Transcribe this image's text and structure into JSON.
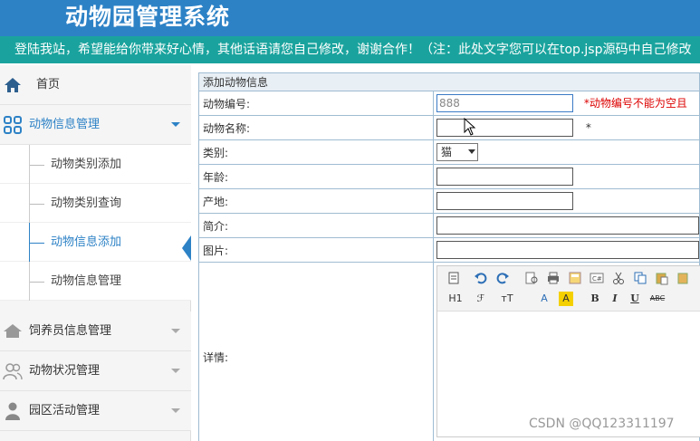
{
  "header": {
    "app_title": "动物园管理系统",
    "marquee": "登陆我站，希望能给你带来好心情，其他话语请您自己修改，谢谢合作！（注：此处文字您可以在top.jsp源码中自己修改"
  },
  "sidebar": {
    "home": "首页",
    "animal_info_mgmt": "动物信息管理",
    "sub_items": [
      "动物类别添加",
      "动物类别查询",
      "动物信息添加",
      "动物信息管理"
    ],
    "keeper_mgmt": "饲养员信息管理",
    "status_mgmt": "动物状况管理",
    "activity_mgmt": "园区活动管理"
  },
  "form": {
    "caption": "添加动物信息",
    "labels": {
      "code": "动物编号:",
      "name": "动物名称:",
      "category": "类别:",
      "age": "年龄:",
      "origin": "产地:",
      "intro": "简介:",
      "image": "图片:",
      "detail": "详情:"
    },
    "values": {
      "code": "888",
      "name": "",
      "category": "猫",
      "age": "",
      "origin": "",
      "intro": "",
      "image": ""
    },
    "code_error": "*动物编号不能为空且",
    "name_required": "*"
  },
  "editor_toolbar": {
    "heading": "H1",
    "font_family": "ℱ",
    "font_size": "тT",
    "font_color": "A",
    "highlight": "A",
    "bold": "B",
    "italic": "I",
    "underline": "U",
    "strike": "ABC"
  },
  "watermark": "CSDN @QQ123311197",
  "colors": {
    "header_bg": "#2d82c6",
    "marquee_bg": "#1aa39e",
    "accent": "#2d82c6",
    "error": "#dd0000"
  }
}
